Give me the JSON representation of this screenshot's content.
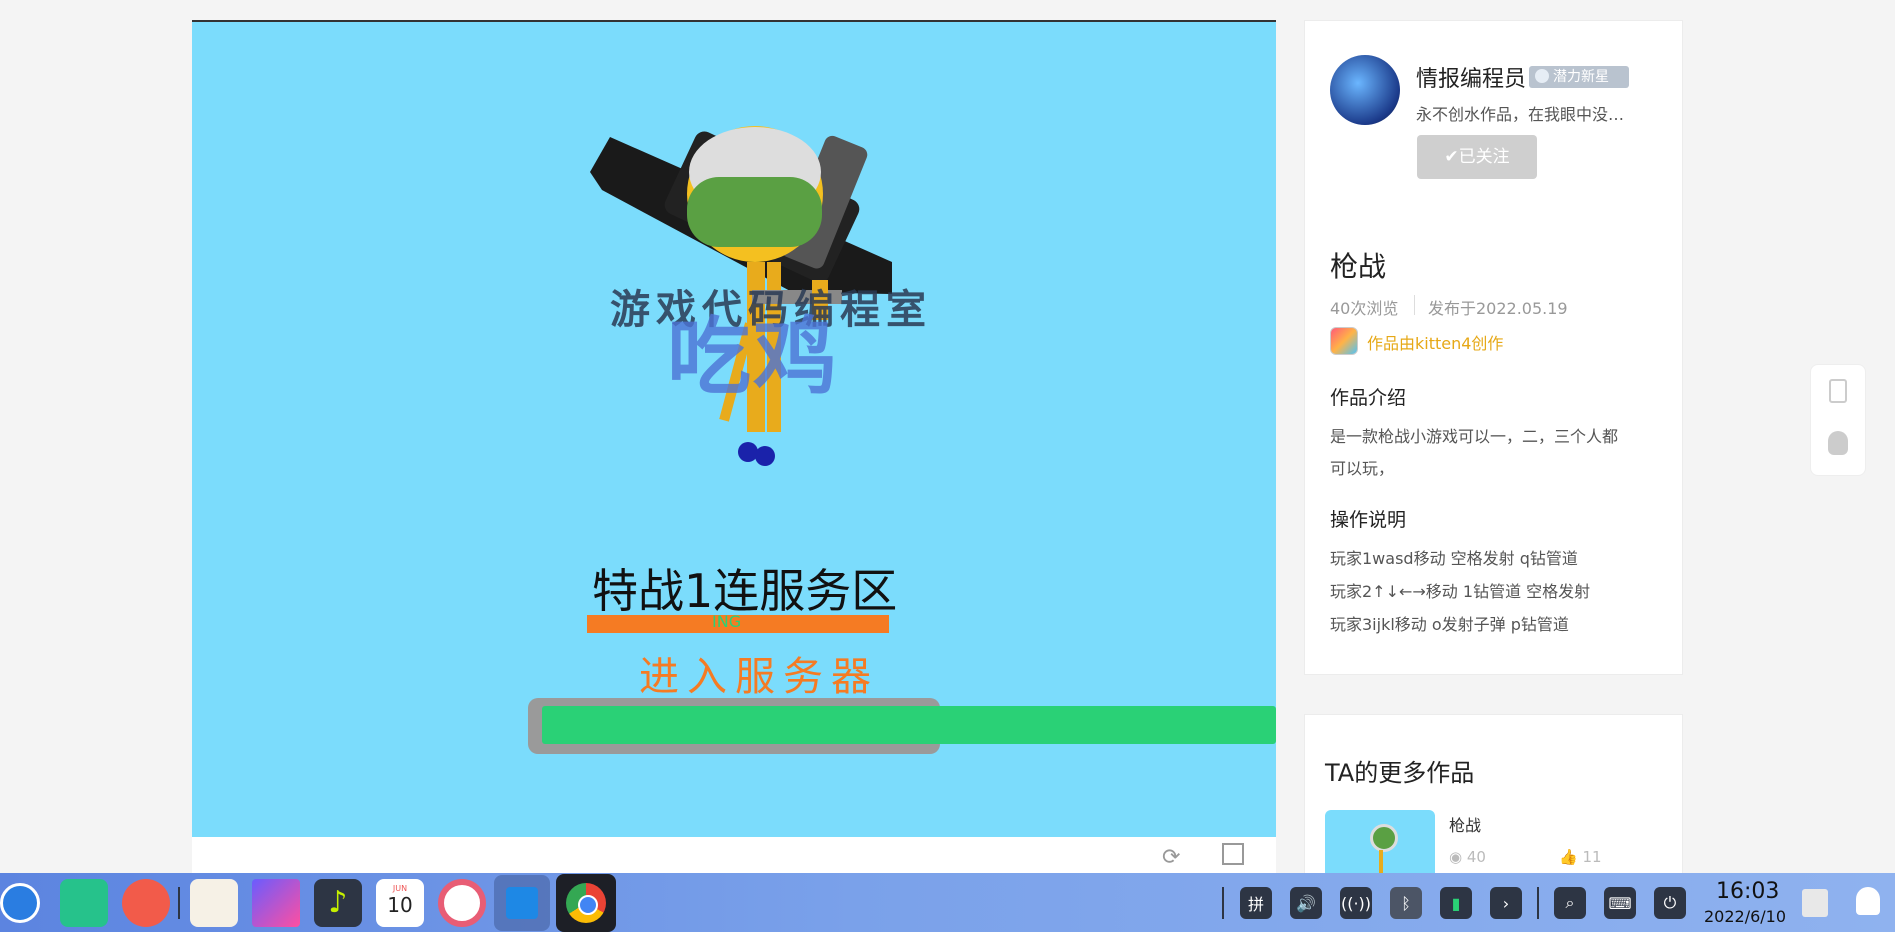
{
  "game": {
    "watermark_top": "游戏代码编程室",
    "watermark_big": "吃鸡",
    "server_title": "特战1连服务区",
    "server_small": "ING",
    "enter_button": "进入服务器",
    "progress": 1.0
  },
  "author": {
    "name": "情报编程员",
    "badge": "潜力新星",
    "bio": "永不创水作品，在我眼中没…",
    "follow_label": "已关注"
  },
  "work": {
    "title": "枪战",
    "views": "40次浏览",
    "published": "发布于2022.05.19",
    "made_with": "作品由kitten4创作",
    "intro_heading": "作品介绍",
    "intro_line1": "是一款枪战小游戏可以一，二，三个人都",
    "intro_line2": "可以玩，",
    "controls_heading": "操作说明",
    "control1": "玩家1wasd移动 空格发射 q钻管道",
    "control2": "玩家2↑↓←→移动 1钻管道 空格发射",
    "control3": "玩家3ijkl移动 o发射子弹 p钻管道"
  },
  "more": {
    "heading": "TA的更多作品",
    "item_title": "枪战",
    "item_views": "40",
    "item_likes": "11"
  },
  "taskbar": {
    "calendar_month": "JUN",
    "calendar_day": "10",
    "ime": "拼",
    "time": "16:03",
    "date": "2022/6/10"
  },
  "colors": {
    "game_bg": "#7bdcfc",
    "accent_orange": "#f57b23",
    "progress_green": "#2ad176",
    "kitten_gold": "#e6a817"
  }
}
